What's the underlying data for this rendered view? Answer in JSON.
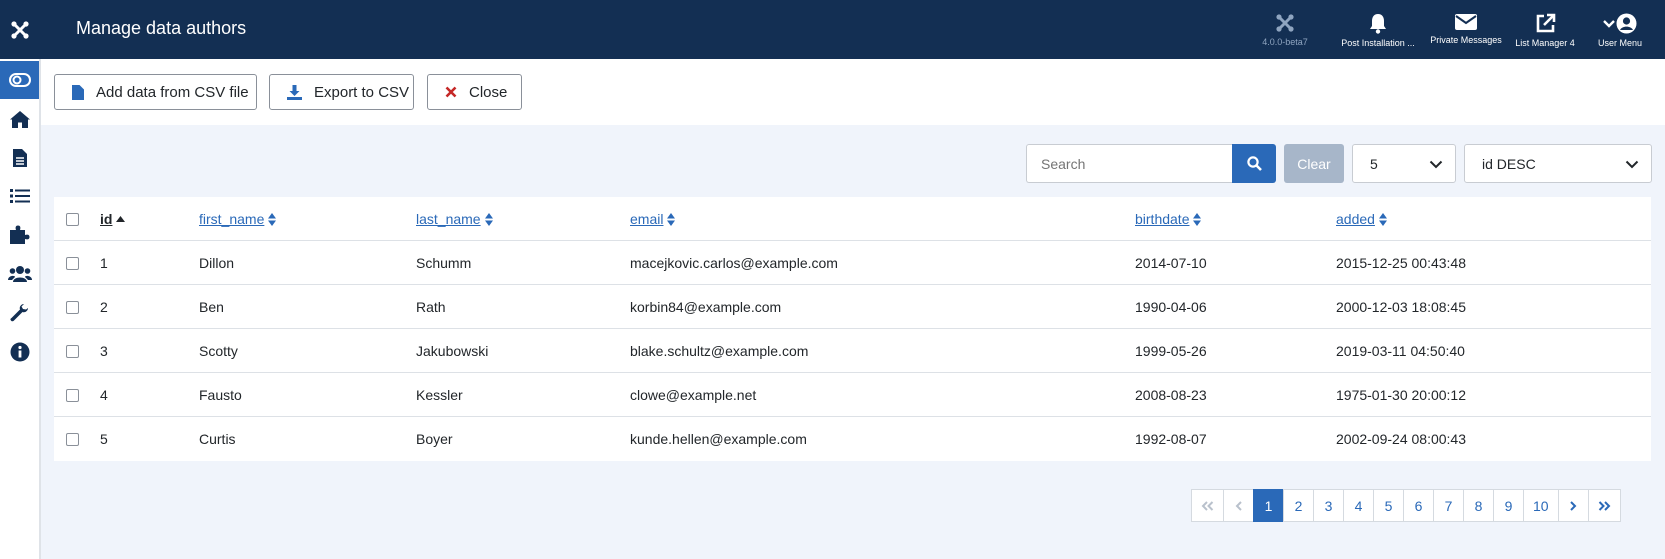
{
  "header": {
    "title": "Manage data authors",
    "items": [
      {
        "label": "4.0.0-beta7",
        "icon": "joomla-icon"
      },
      {
        "label": "Post Installation ...",
        "icon": "bell-icon"
      },
      {
        "label": "Private Messages",
        "icon": "envelope-icon"
      },
      {
        "label": "List Manager 4",
        "icon": "external-link-icon"
      },
      {
        "label": "User Menu",
        "icon": "user-circle-icon"
      }
    ]
  },
  "sidebar": {
    "items": [
      {
        "icon": "toggle-icon",
        "active": true
      },
      {
        "icon": "home-icon"
      },
      {
        "icon": "file-icon"
      },
      {
        "icon": "list-icon"
      },
      {
        "icon": "puzzle-icon"
      },
      {
        "icon": "users-icon"
      },
      {
        "icon": "wrench-icon"
      },
      {
        "icon": "info-icon"
      }
    ]
  },
  "toolbar": {
    "add_csv_label": "Add data from CSV file",
    "export_csv_label": "Export to CSV",
    "close_label": "Close"
  },
  "filters": {
    "search_placeholder": "Search",
    "clear_label": "Clear",
    "limit_value": "5",
    "ordering_value": "id DESC"
  },
  "table": {
    "columns": [
      "id",
      "first_name",
      "last_name",
      "email",
      "birthdate",
      "added"
    ],
    "rows": [
      [
        "1",
        "Dillon",
        "Schumm",
        "macejkovic.carlos@example.com",
        "2014-07-10",
        "2015-12-25 00:43:48"
      ],
      [
        "2",
        "Ben",
        "Rath",
        "korbin84@example.com",
        "1990-04-06",
        "2000-12-03 18:08:45"
      ],
      [
        "3",
        "Scotty",
        "Jakubowski",
        "blake.schultz@example.com",
        "1999-05-26",
        "2019-03-11 04:50:40"
      ],
      [
        "4",
        "Fausto",
        "Kessler",
        "clowe@example.net",
        "2008-08-23",
        "1975-01-30 20:00:12"
      ],
      [
        "5",
        "Curtis",
        "Boyer",
        "kunde.hellen@example.com",
        "1992-08-07",
        "2002-09-24 08:00:43"
      ]
    ]
  },
  "pagination": {
    "pages": [
      "1",
      "2",
      "3",
      "4",
      "5",
      "6",
      "7",
      "8",
      "9",
      "10"
    ],
    "current": "1"
  },
  "colors": {
    "header_bg": "#132f53",
    "accent": "#2a69b8",
    "close_red": "#c52827"
  }
}
